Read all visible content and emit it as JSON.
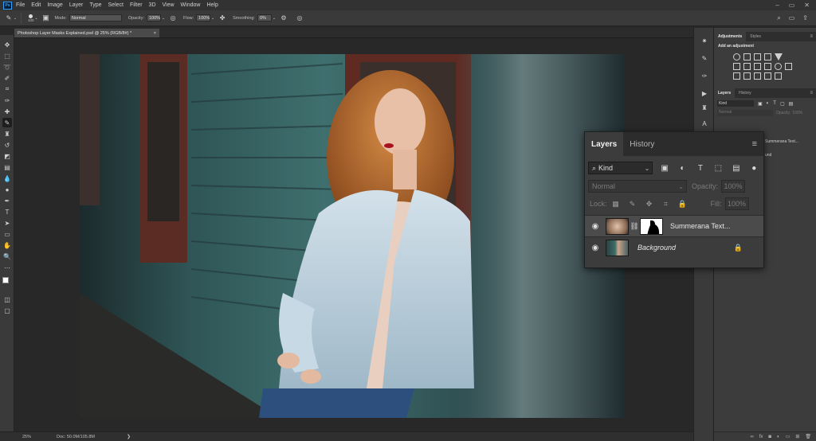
{
  "app": {
    "logo": "Ps",
    "menu": [
      "File",
      "Edit",
      "Image",
      "Layer",
      "Type",
      "Select",
      "Filter",
      "3D",
      "View",
      "Window",
      "Help"
    ]
  },
  "options": {
    "brush_size": "100",
    "mode_label": "Mode:",
    "mode_value": "Normal",
    "opacity_label": "Opacity:",
    "opacity_value": "100%",
    "flow_label": "Flow:",
    "flow_value": "100%",
    "smoothing_label": "Smoothing:",
    "smoothing_value": "0%"
  },
  "document": {
    "tab_title": "Photoshop Layer Masks Explained.psd @ 25% (RGB/8#) *",
    "close": "×"
  },
  "status": {
    "zoom": "25%",
    "doc_info": "Doc: 50.0M/105.8M"
  },
  "right_panel": {
    "adj_tabs": [
      "Adjustments",
      "Styles"
    ],
    "adj_title": "Add an adjustment",
    "layers_tabs": [
      "Layers",
      "History"
    ],
    "kind": "Kind",
    "blend": "Normal",
    "opacity_label": "Opacity:",
    "opacity_value": "100%",
    "bg_layer_text": "Summerana Text...",
    "bg_layer_text2": "und"
  },
  "layers_panel": {
    "tabs": [
      "Layers",
      "History"
    ],
    "kind_filter": "Kind",
    "blend_mode": "Normal",
    "opacity_label": "Opacity:",
    "opacity_value": "100%",
    "lock_label": "Lock:",
    "fill_label": "Fill:",
    "fill_value": "100%",
    "layers": [
      {
        "name": "Summerana Text...",
        "visible": true,
        "has_mask": true,
        "italic": false
      },
      {
        "name": "Background",
        "visible": true,
        "has_mask": false,
        "italic": true,
        "locked": true
      }
    ]
  },
  "colors": {
    "accent": "#2fa3ff",
    "panel_bg": "#3c3c3c",
    "canvas_bg": "#282828"
  }
}
